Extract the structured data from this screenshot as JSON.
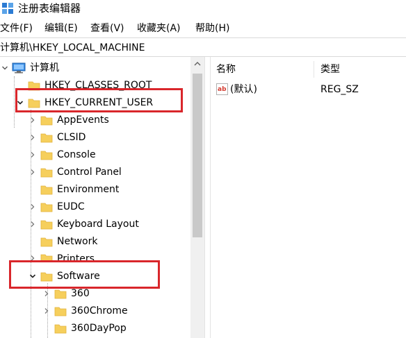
{
  "window": {
    "title": "注册表编辑器"
  },
  "menu": [
    "文件(F)",
    "编辑(E)",
    "查看(V)",
    "收藏夹(A)",
    "帮助(H)"
  ],
  "address": "计算机\\HKEY_LOCAL_MACHINE",
  "tree": {
    "root": "计算机",
    "hives": [
      "HKEY_CLASSES_ROOT",
      "HKEY_CURRENT_USER"
    ],
    "hkcu_children": [
      "AppEvents",
      "CLSID",
      "Console",
      "Control Panel",
      "Environment",
      "EUDC",
      "Keyboard Layout",
      "Network",
      "Printers",
      "Software"
    ],
    "software_children": [
      "360",
      "360Chrome",
      "360DayPop"
    ]
  },
  "list": {
    "columns": [
      "名称",
      "类型"
    ],
    "rows": [
      {
        "name": "(默认)",
        "type": "REG_SZ"
      }
    ]
  },
  "colors": {
    "folder": "#f6cf5c",
    "folder_dark": "#e2b33c",
    "highlight": "#d9262b",
    "chevron": "#555555"
  },
  "icons": {
    "app": "registry-editor-icon",
    "computer": "computer-icon",
    "folder": "folder-icon",
    "string_value": "string-value-icon"
  }
}
